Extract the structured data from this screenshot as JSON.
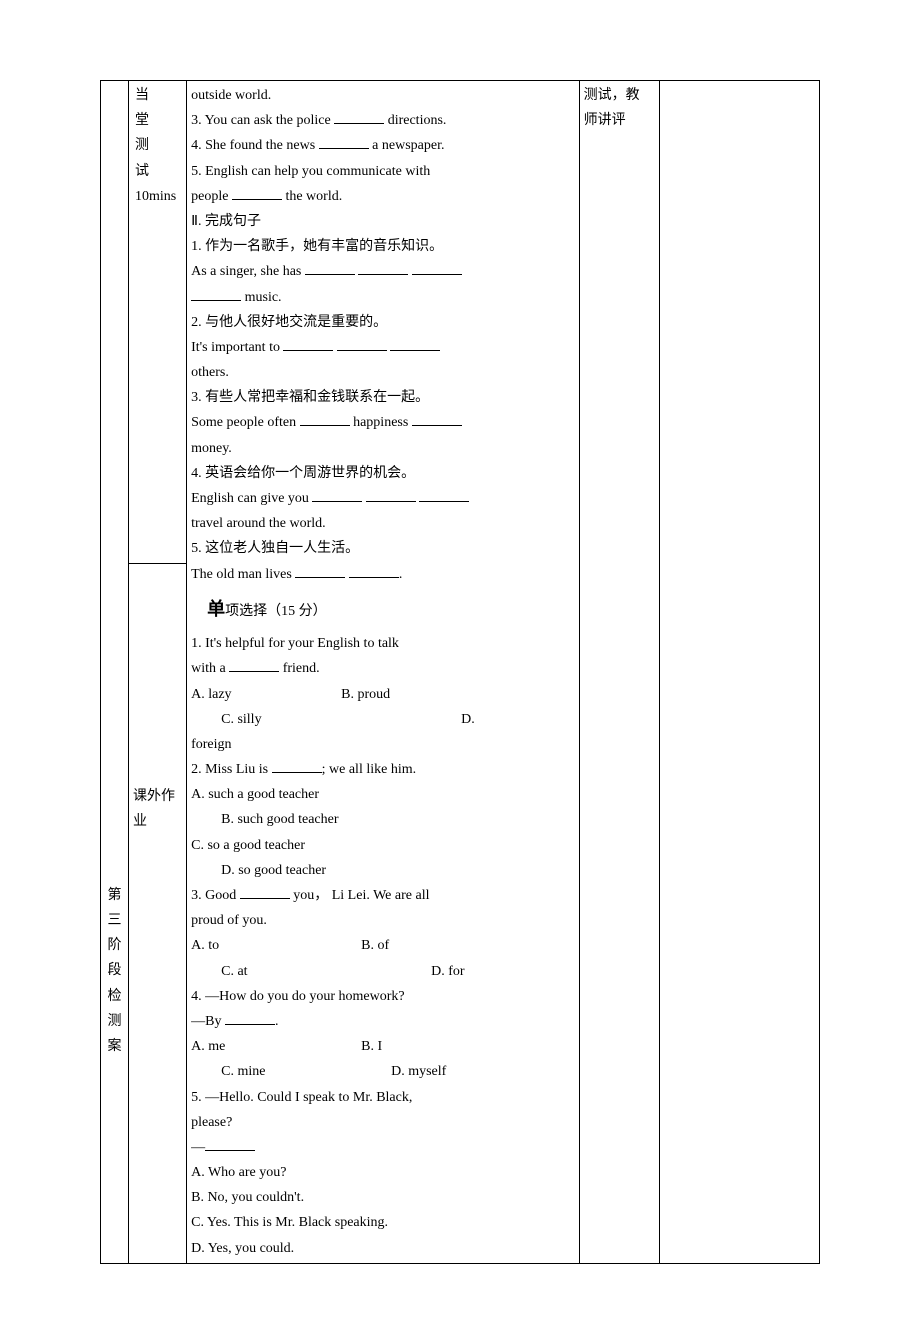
{
  "col1_upper": "",
  "col2_upper": {
    "l1": "当",
    "l2": "堂",
    "l3": "测",
    "l4": "试",
    "l5": "10mins"
  },
  "col4_upper": {
    "l1": "测试，教",
    "l2": "师讲评"
  },
  "col1_lower": {
    "l1": "第",
    "l2": "三",
    "l3": "阶",
    "l4": "段",
    "l5": "检",
    "l6": "测",
    "l7": "案"
  },
  "col2_lower": {
    "l1": "课外作",
    "l2": "业"
  },
  "content": {
    "top": {
      "l1": "outside world.",
      "l2a": "3. You can ask the police ",
      "l2b": " directions.",
      "l3a": "4. She found the news ",
      "l3b": " a newspaper.",
      "l4": "5. English can help you communicate with",
      "l5a": "people ",
      "l5b": " the world.",
      "l6": "Ⅱ. 完成句子",
      "l7": "1. 作为一名歌手，她有丰富的音乐知识。",
      "l8a": "As a singer, she has ",
      "l9a": " music.",
      "l10": "2. 与他人很好地交流是重要的。",
      "l11a": "It's important to ",
      "l12": "others.",
      "l13": "3. 有些人常把幸福和金钱联系在一起。",
      "l14a": "Some people often ",
      "l14b": " happiness ",
      "l15": "money.",
      "l16": "4. 英语会给你一个周游世界的机会。",
      "l17a": "English can give you ",
      "l18": "travel around the world.",
      "l19": "5. 这位老人独自一人生活。",
      "l20a": "The old man lives ",
      "l20b": "."
    },
    "mc": {
      "hdr_big": "单",
      "hdr_rest": "项选择（15 分）",
      "q1a": "1. It's helpful for your English to talk",
      "q1b_a": "with a ",
      "q1b_b": " friend.",
      "q1c": "A. lazy",
      "q1d": "B. proud",
      "q1e": "C. silly",
      "q1f": "D.",
      "q1g": "foreign",
      "q2a_a": "2. Miss Liu is ",
      "q2a_b": "; we all like him.",
      "q2b": "A. such a good teacher",
      "q2c": "B. such good teacher",
      "q2d": "C. so a good teacher",
      "q2e": "D. so good teacher",
      "q3a_a": "3. Good ",
      "q3a_b": " you， Li Lei. We are all",
      "q3b": "proud of you.",
      "q3c": "A. to",
      "q3d": "B. of",
      "q3e": "C. at",
      "q3f": "D. for",
      "q4a": "4. —How do you do your homework?",
      "q4b_a": "—By ",
      "q4b_b": ".",
      "q4c": "A. me",
      "q4d": "B. I",
      "q4e": "C. mine",
      "q4f": "D. myself",
      "q5a": "5. —Hello. Could I speak to Mr. Black,",
      "q5b": "please?",
      "q5c": "—",
      "q5d": "A. Who are you?",
      "q5e": "B. No, you couldn't.",
      "q5f": "C. Yes. This is Mr. Black speaking.",
      "q5g": "D. Yes, you could."
    }
  }
}
